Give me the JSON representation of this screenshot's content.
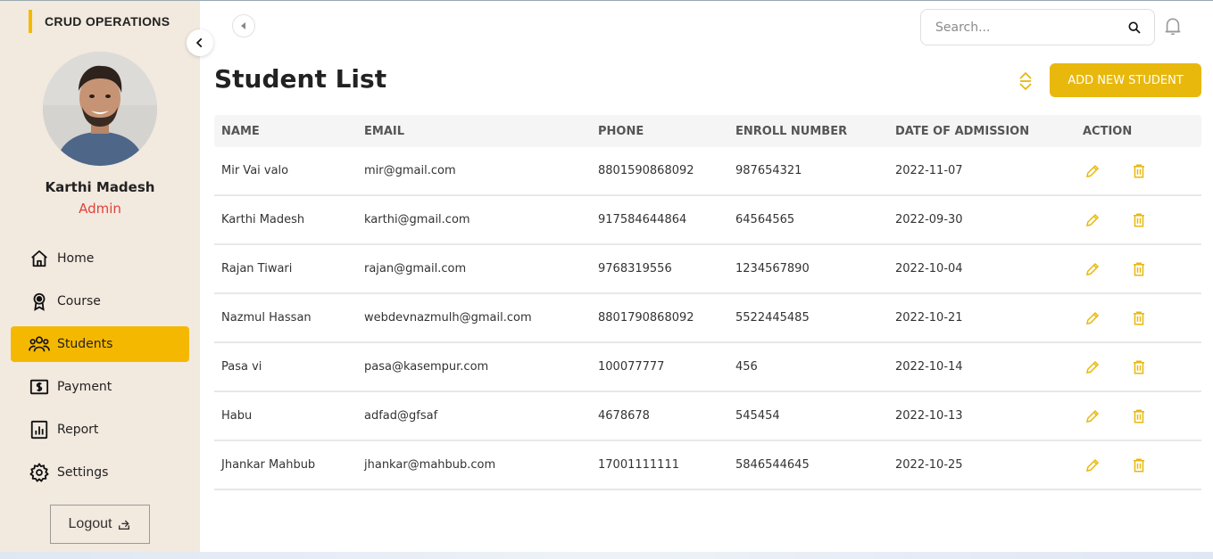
{
  "sidebar": {
    "brand": "CRUD OPERATIONS",
    "user_name": "Karthi Madesh",
    "user_role": "Admin",
    "items": [
      {
        "label": "Home",
        "icon": "home-icon",
        "active": false
      },
      {
        "label": "Course",
        "icon": "award-icon",
        "active": false
      },
      {
        "label": "Students",
        "icon": "users-icon",
        "active": true
      },
      {
        "label": "Payment",
        "icon": "dollar-icon",
        "active": false
      },
      {
        "label": "Report",
        "icon": "report-icon",
        "active": false
      },
      {
        "label": "Settings",
        "icon": "gear-icon",
        "active": false
      }
    ],
    "logout_label": "Logout"
  },
  "header": {
    "search_placeholder": "Search..."
  },
  "main": {
    "title": "Student List",
    "add_button_label": "ADD NEW STUDENT",
    "columns": [
      "NAME",
      "EMAIL",
      "PHONE",
      "ENROLL NUMBER",
      "DATE OF ADMISSION",
      "ACTION"
    ],
    "rows": [
      {
        "name": "Mir Vai valo",
        "email": "mir@gmail.com",
        "phone": "8801590868092",
        "enroll": "987654321",
        "date": "2022-11-07"
      },
      {
        "name": "Karthi Madesh",
        "email": "karthi@gmail.com",
        "phone": "917584644864",
        "enroll": "64564565",
        "date": "2022-09-30"
      },
      {
        "name": "Rajan Tiwari",
        "email": "rajan@gmail.com",
        "phone": "9768319556",
        "enroll": "1234567890",
        "date": "2022-10-04"
      },
      {
        "name": "Nazmul Hassan",
        "email": "webdevnazmulh@gmail.com",
        "phone": "8801790868092",
        "enroll": "5522445485",
        "date": "2022-10-21"
      },
      {
        "name": "Pasa vi",
        "email": "pasa@kasempur.com",
        "phone": "100077777",
        "enroll": "456",
        "date": "2022-10-14"
      },
      {
        "name": "Habu",
        "email": "adfad@gfsaf",
        "phone": "4678678",
        "enroll": "545454",
        "date": "2022-10-13"
      },
      {
        "name": "Jhankar Mahbub",
        "email": "jhankar@mahbub.com",
        "phone": "17001111111",
        "enroll": "5846544645",
        "date": "2022-10-25"
      }
    ]
  },
  "colors": {
    "accent": "#f5b800",
    "button": "#e8b80c",
    "sidebar_bg": "#f2e9df",
    "role": "#e0433b"
  }
}
